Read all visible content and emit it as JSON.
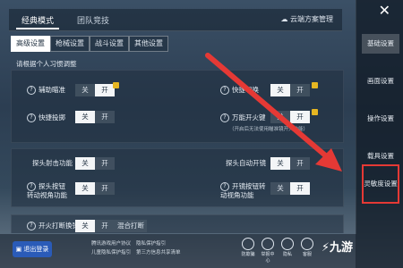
{
  "tabs": [
    "经典模式",
    "团队竞技"
  ],
  "cloud_label": "云端方案管理",
  "subtabs": [
    "高级设置",
    "枪械设置",
    "战斗设置",
    "其他设置"
  ],
  "hint": "请根据个人习惯调整",
  "settings": {
    "aim_assist": {
      "label": "辅助瞄准",
      "off": "关",
      "on": "开"
    },
    "quick_throw": {
      "label": "快捷投掷",
      "off": "关",
      "on": "开"
    },
    "quick_switch": {
      "label": "快捷切换",
      "off": "关",
      "on": "开"
    },
    "universal_fire": {
      "label": "万能开火键",
      "off": "关",
      "on": "开",
      "note": "（开启后无法使用瞄准镜开火功能）"
    },
    "peek_fire": {
      "label": "探头射击功能",
      "off": "关",
      "on": "开"
    },
    "auto_open_door": {
      "label": "探头自动开镜",
      "off": "关",
      "on": "开"
    },
    "peek_drag": {
      "label": "探头按钮转动视角功能",
      "off": "关",
      "on": "开"
    },
    "fire_drag": {
      "label": "开镜按钮转动视角功能",
      "off": "关",
      "on": "开"
    },
    "partial": {
      "label": "开火打断换弹",
      "off": "关",
      "on": "开",
      "extra": "混合打断"
    }
  },
  "right_menu": [
    "基础设置",
    "画面设置",
    "操作设置",
    "载具设置",
    "灵敏度设置"
  ],
  "close_label": "✕",
  "logout": "退出登录",
  "links": [
    "腾讯游戏用户协议",
    "隐私保护指引",
    "儿童隐私保护指引",
    "第三方信息共享清单"
  ],
  "bottom_icons": [
    "防欺骗",
    "举报中心",
    "隐私",
    "客服"
  ],
  "logo": "九游",
  "colors": {
    "highlight": "#e53935",
    "accent": "#2a5bb8"
  }
}
